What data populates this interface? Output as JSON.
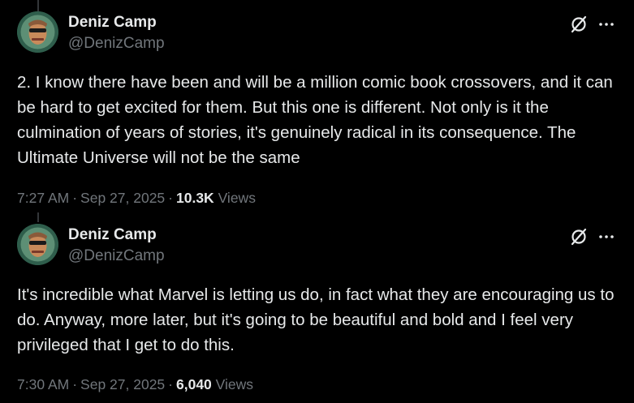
{
  "posts": [
    {
      "author": {
        "name": "Deniz Camp",
        "handle": "@DenizCamp"
      },
      "text": "2. I know there have been and will be a million comic book crossovers, and it can be hard to get excited for them. But this one is different. Not only is it the culmination of years of stories, it's genuinely radical in its consequence. The Ultimate Universe will not be the same",
      "time": "7:27 AM",
      "date": "Sep 27, 2025",
      "views_count": "10.3K",
      "views_label": "Views"
    },
    {
      "author": {
        "name": "Deniz Camp",
        "handle": "@DenizCamp"
      },
      "text": "It's incredible what Marvel is letting us do, in fact what they are encouraging us to do. Anyway, more later, but it's going to be beautiful and bold and I feel very privileged that I get to do this.",
      "time": "7:30 AM",
      "date": "Sep 27, 2025",
      "views_count": "6,040",
      "views_label": "Views"
    }
  ],
  "meta_separator": "·",
  "colors": {
    "background": "#000000",
    "text_primary": "#e7e9ea",
    "text_secondary": "#71767b",
    "thread_line": "#333639",
    "avatar_bg": "#2f5e4c"
  },
  "icons": {
    "grok": "grok-slash-icon",
    "more": "more-horizontal-icon"
  }
}
